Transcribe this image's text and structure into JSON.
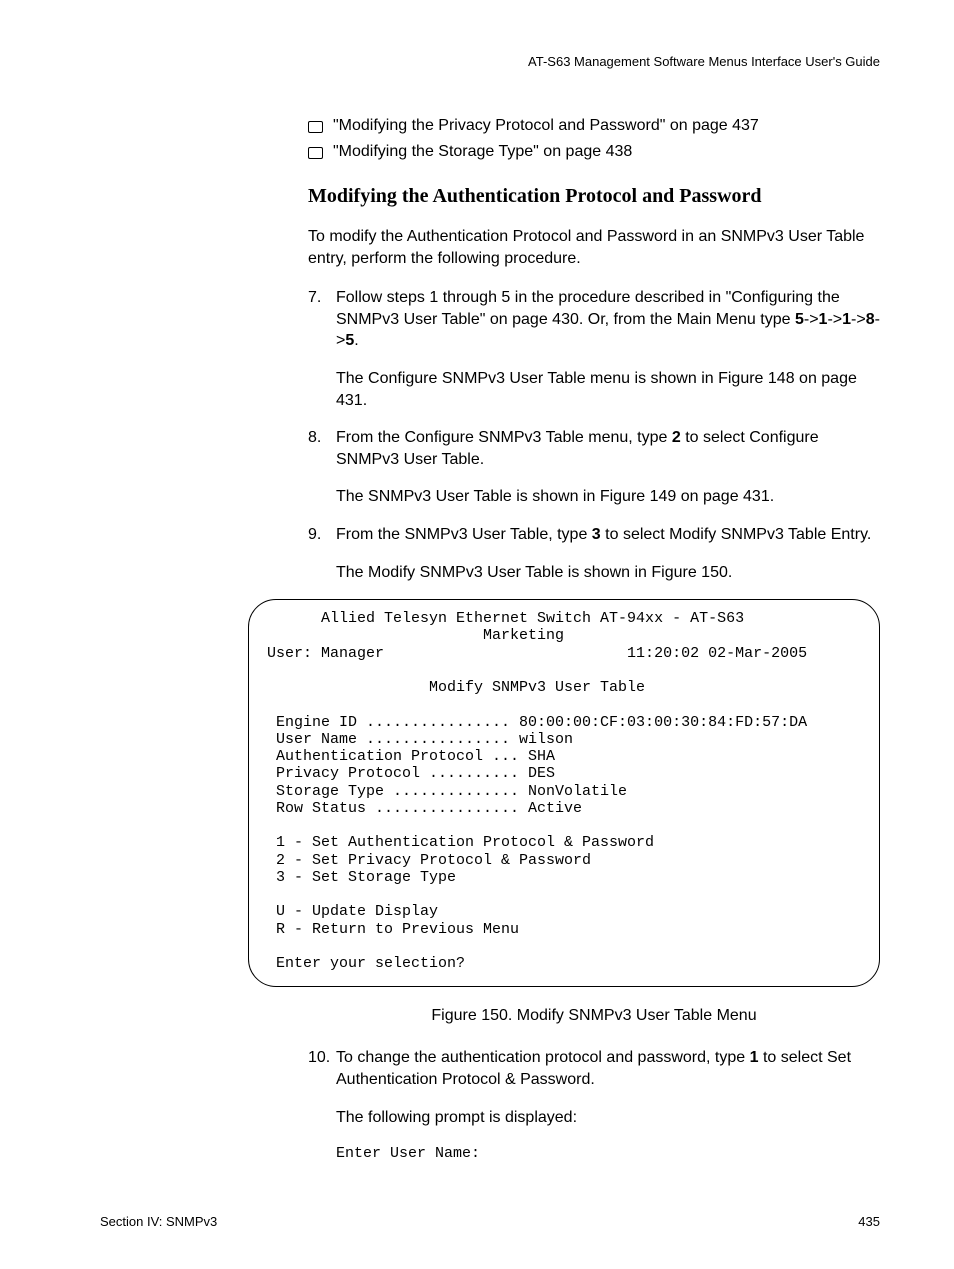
{
  "header": {
    "title": "AT-S63 Management Software Menus Interface User's Guide"
  },
  "bullets": {
    "b0": "\"Modifying the Privacy Protocol and Password\" on page 437",
    "b1": "\"Modifying the Storage Type\" on page 438"
  },
  "heading": "Modifying the Authentication Protocol and Password",
  "intro": "To modify the Authentication Protocol and Password in an SNMPv3 User Table entry, perform the following procedure.",
  "steps": {
    "s7": {
      "num": "7.",
      "t1a": "Follow steps 1 through 5 in the procedure described in \"Configuring the SNMPv3 User Table\" on page 430. Or, from the Main Menu type ",
      "t1b": "5",
      "t1c": "->",
      "t1d": "1",
      "t1e": "->",
      "t1f": "1",
      "t1g": "->",
      "t1h": "8",
      "t1i": "->",
      "t1j": "5",
      "t1k": ".",
      "t2": "The Configure SNMPv3 User Table menu is shown in Figure 148 on page 431."
    },
    "s8": {
      "num": "8.",
      "t1a": "From the Configure SNMPv3 Table menu, type ",
      "t1b": "2",
      "t1c": " to select Configure SNMPv3 User Table.",
      "t2": "The SNMPv3 User Table is shown in Figure 149 on page 431."
    },
    "s9": {
      "num": "9.",
      "t1a": "From the SNMPv3 User Table, type ",
      "t1b": "3",
      "t1c": " to select Modify SNMPv3 Table Entry.",
      "t2": "The Modify SNMPv3 User Table is shown in Figure 150."
    },
    "s10": {
      "num": "10.",
      "t1a": "To change the authentication protocol and password, type ",
      "t1b": "1",
      "t1c": " to select Set Authentication Protocol & Password.",
      "t2": "The following prompt is displayed:",
      "prompt": "Enter User Name:"
    }
  },
  "terminal": {
    "line1": "      Allied Telesyn Ethernet Switch AT-94xx - AT-S63",
    "line2": "                        Marketing",
    "line3": "User: Manager                           11:20:02 02-Mar-2005",
    "line4": "                  Modify SNMPv3 User Table",
    "line5": " Engine ID ................ 80:00:00:CF:03:00:30:84:FD:57:DA",
    "line6": " User Name ................ wilson",
    "line7": " Authentication Protocol ... SHA",
    "line8": " Privacy Protocol .......... DES",
    "line9": " Storage Type .............. NonVolatile",
    "line10": " Row Status ................ Active",
    "line11": " 1 - Set Authentication Protocol & Password",
    "line12": " 2 - Set Privacy Protocol & Password",
    "line13": " 3 - Set Storage Type",
    "line14": " U - Update Display",
    "line15": " R - Return to Previous Menu",
    "line16": " Enter your selection?"
  },
  "figure_caption": "Figure 150. Modify SNMPv3 User Table Menu",
  "footer": {
    "left": "Section IV: SNMPv3",
    "right": "435"
  }
}
